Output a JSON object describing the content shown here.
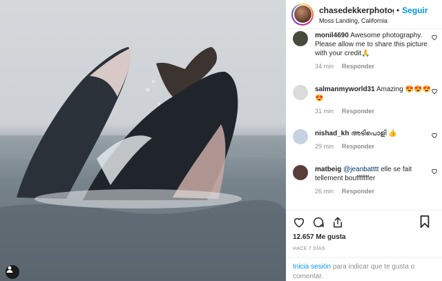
{
  "post": {
    "username": "chasedekkerphotograp",
    "dot": "•",
    "follow_label": "Seguir",
    "location": "Moss Landing, California",
    "more_icon": "more-horizontal-icon"
  },
  "comments": [
    {
      "user": "monil4690",
      "text": "Awesome photography. Please allow me to share this picture with your credit🙏",
      "time": "34 min",
      "reply": "Responder",
      "avatar_color": "#4a4a3c"
    },
    {
      "user": "salmanmyworld31",
      "text": "Amazing 😍😍😍😍",
      "time": "31 min",
      "reply": "Responder",
      "avatar_color": "#dbdbdb"
    },
    {
      "user": "nishad_kh",
      "text": "അടിപൊളി 👍",
      "time": "29 min",
      "reply": "Responder",
      "avatar_color": "#c5d3e0"
    },
    {
      "user": "matbeig",
      "mention": "@jeanbatttt",
      "text": "elle se fait tellement boufffffffer",
      "time": "26 min",
      "reply": "Responder",
      "avatar_color": "#5a3d3a"
    }
  ],
  "actions": {
    "like_icon": "heart-icon",
    "comment_icon": "comment-icon",
    "share_icon": "share-icon",
    "save_icon": "bookmark-icon"
  },
  "likes_text": "12.657 Me gusta",
  "timestamp": "HACE 7 DÍAS",
  "login": {
    "link": "Inicia sesión",
    "rest": "para indicar que te gusta o comentar."
  },
  "colors": {
    "accent": "#0095f6",
    "text": "#262626",
    "muted": "#8e8e8e"
  }
}
